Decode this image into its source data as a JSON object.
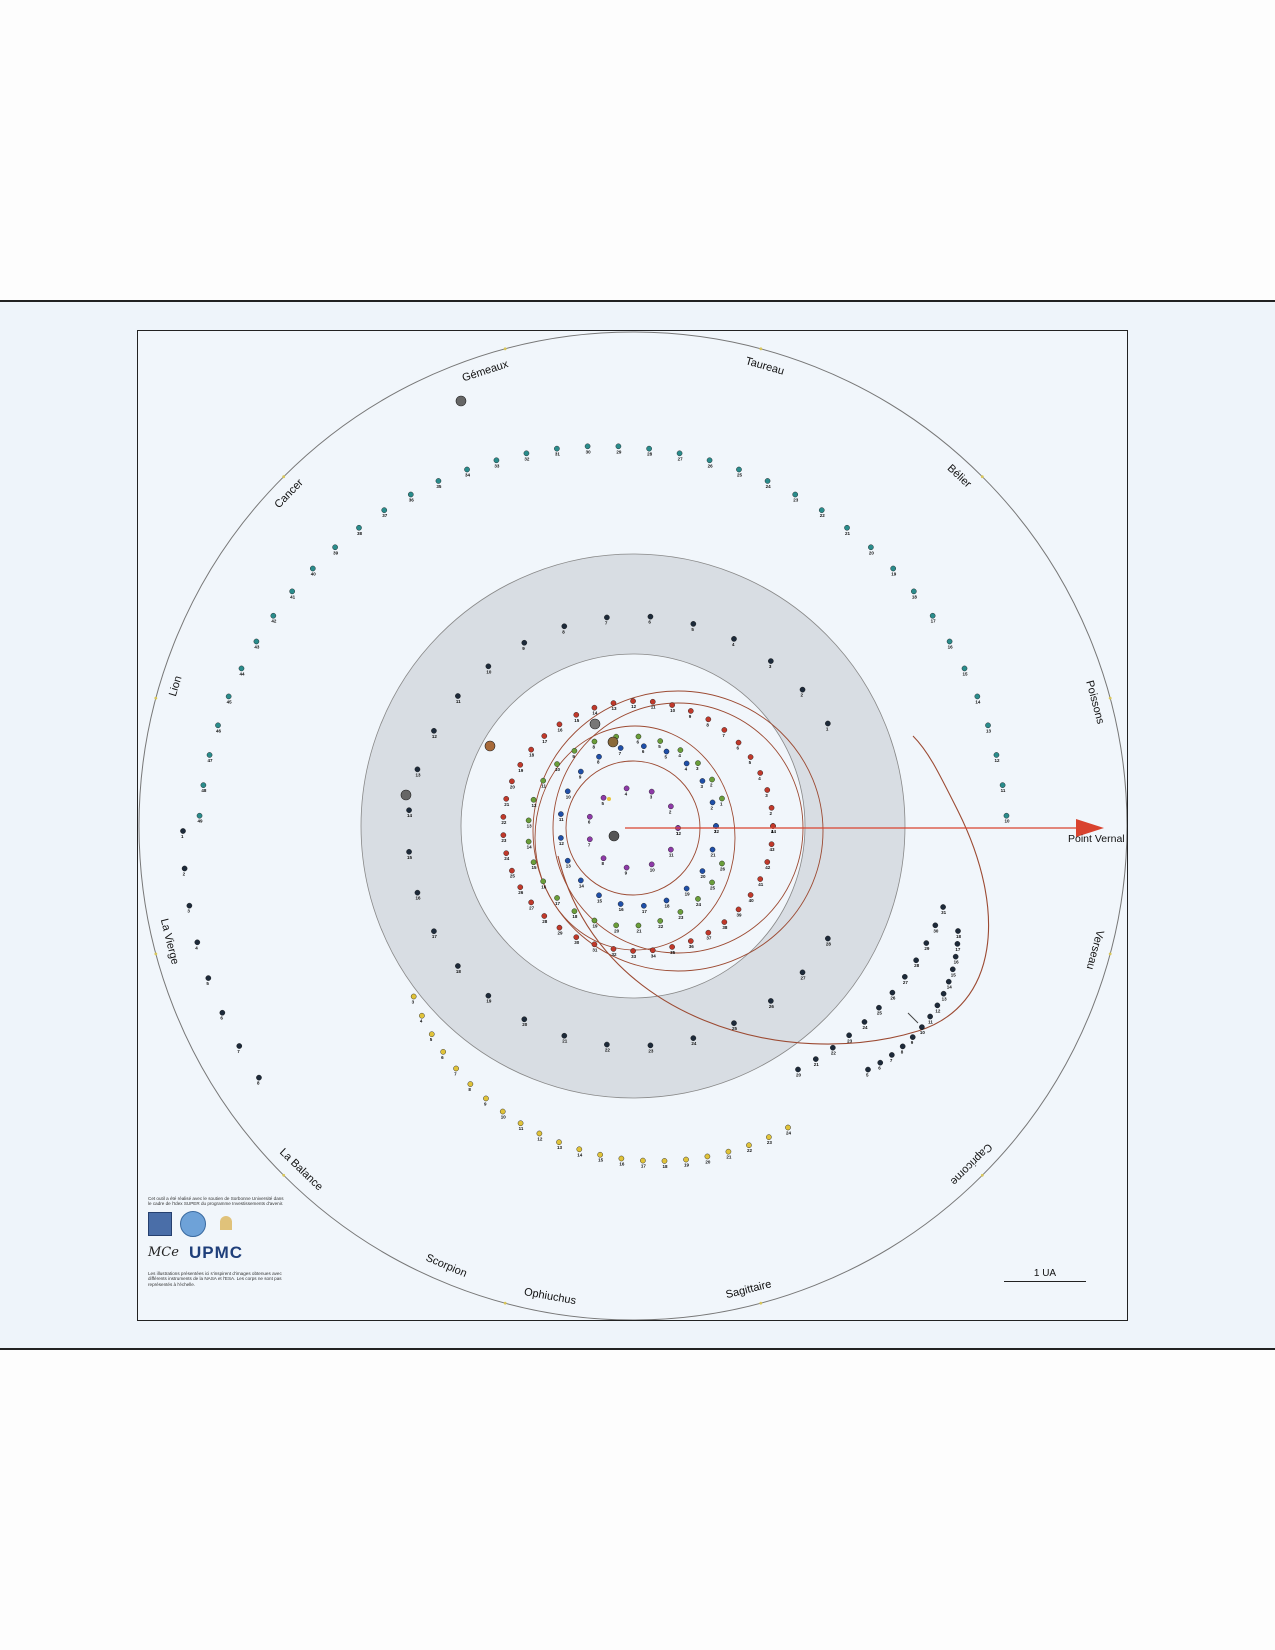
{
  "zodiac": [
    {
      "name": "Gémeaux",
      "angle": 108
    },
    {
      "name": "Taureau",
      "angle": 74
    },
    {
      "name": "Cancer",
      "angle": 136
    },
    {
      "name": "Bélier",
      "angle": 47
    },
    {
      "name": "Lion",
      "angle": 163
    },
    {
      "name": "Poissons",
      "angle": 15
    },
    {
      "name": "La Vierge",
      "angle": 194
    },
    {
      "name": "Verseau",
      "angle": -15
    },
    {
      "name": "La Balance",
      "angle": 226
    },
    {
      "name": "Capricorne",
      "angle": -45
    },
    {
      "name": "Scorpion",
      "angle": 247
    },
    {
      "name": "Ophiuchus",
      "angle": 260
    },
    {
      "name": "Sagittaire",
      "angle": 284
    }
  ],
  "point_vernal_label": "Point Vernal",
  "scale_label": "1 UA",
  "footer": {
    "top_text": "Cet outil a été réalisé avec le soutien de Sorbonne Université dans le cadre de l'Idex SUPER du programme Investissements d'avenir.",
    "bottom_text": "Les illustrations présentées ici s'inspirent d'images obtenues avec différents instruments de la NASA et l'ESA. Les corps ne sont pas représentés à l'échelle.",
    "upmc_text": "UPMC",
    "signature_text": "MCe"
  },
  "colors": {
    "orbit_brown": "#9c4a32",
    "vernal_arrow": "#d9432f",
    "zone_gray": "#d8dde3",
    "marker_dark": "#1d2a3a",
    "marker_red": "#c0392b",
    "marker_blue": "#1f4fa8",
    "marker_yellow": "#e0c33a",
    "marker_green": "#6a9e3a",
    "marker_cyan": "#2a8c8c"
  }
}
